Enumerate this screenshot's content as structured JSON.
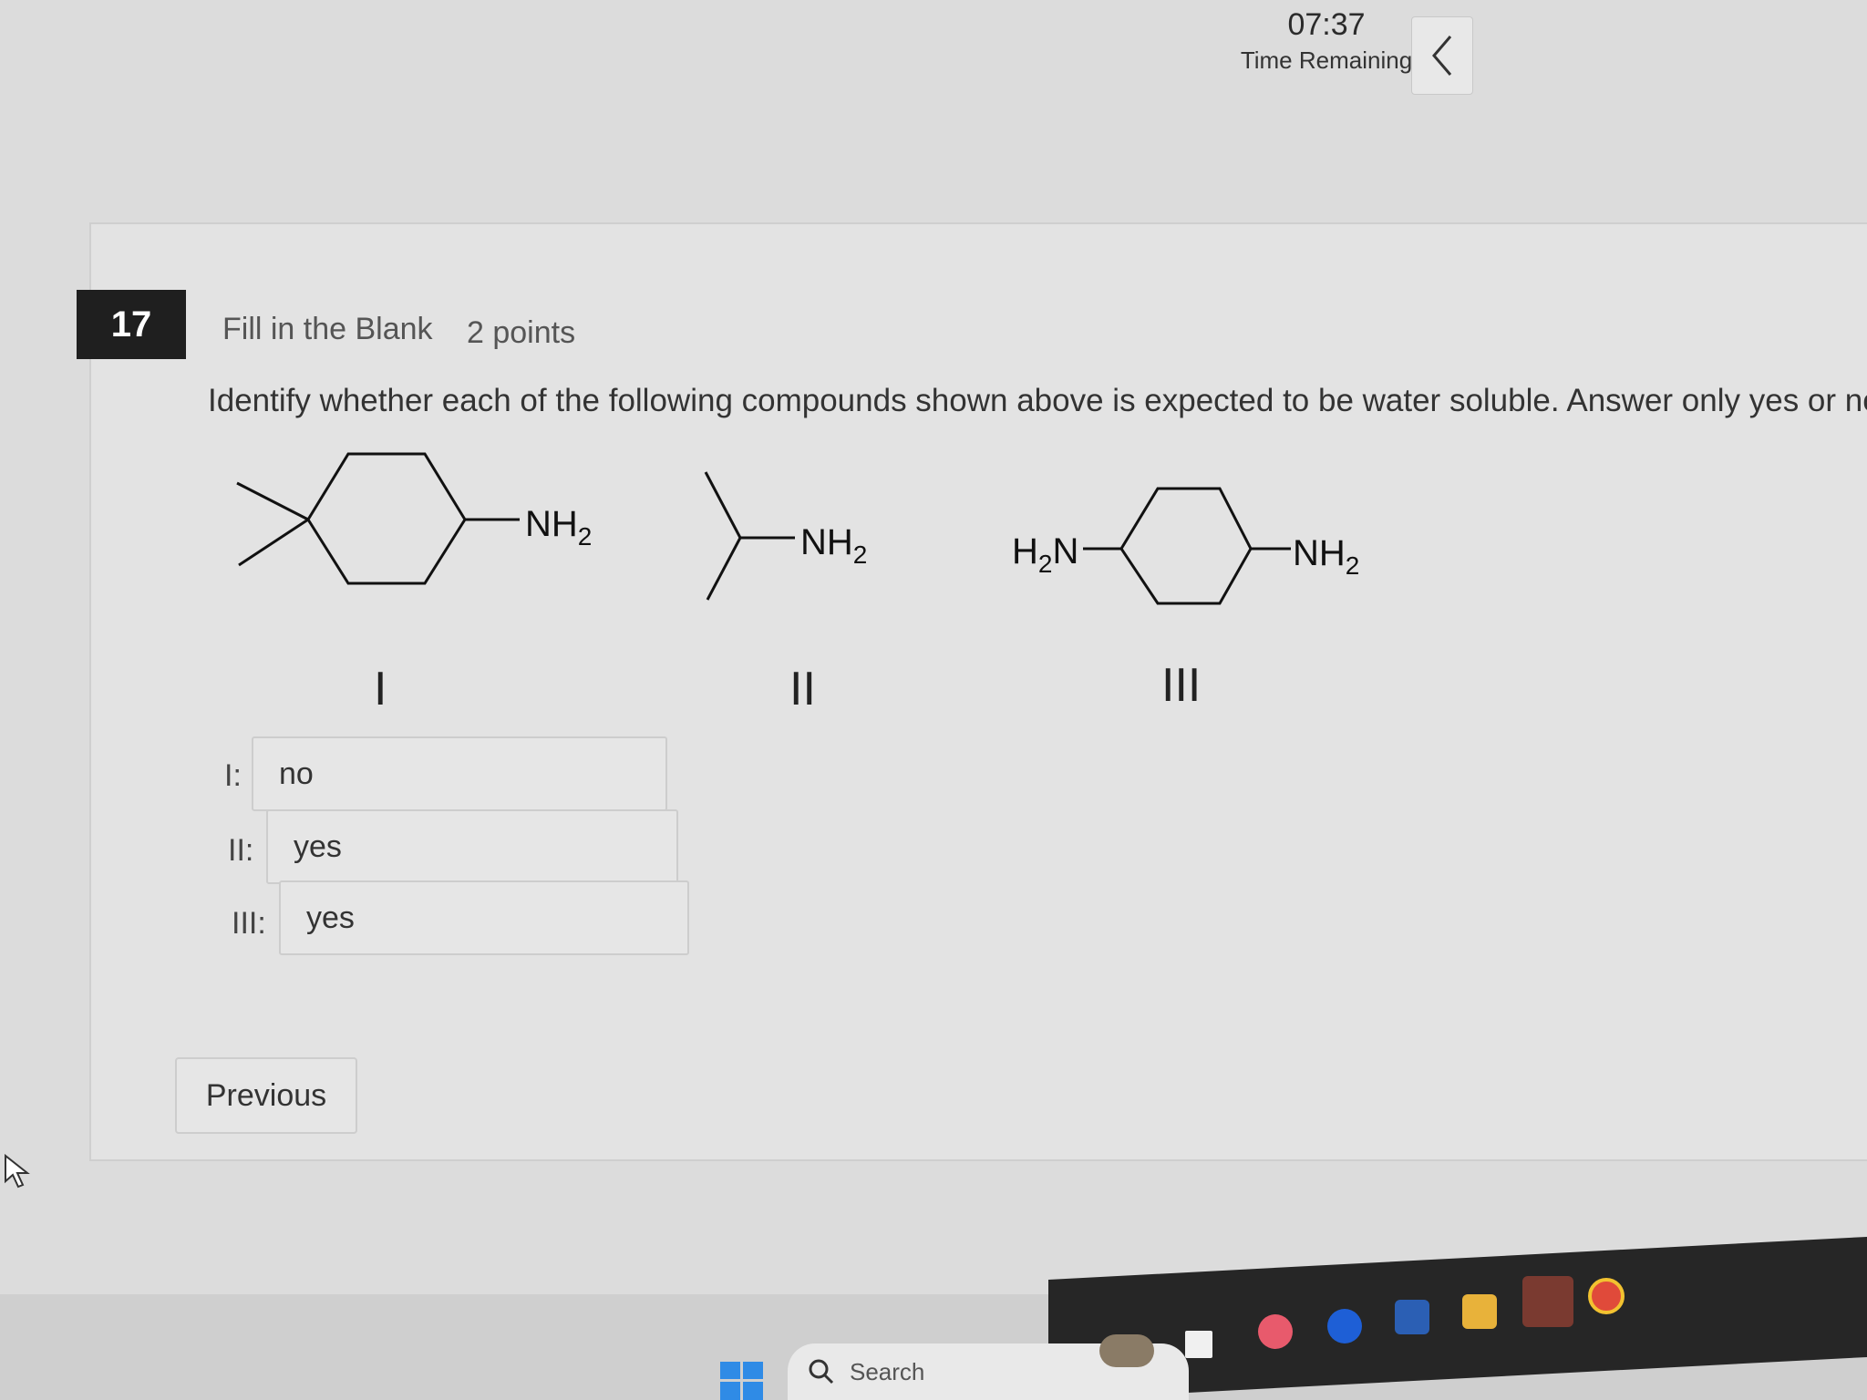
{
  "timer": {
    "time": "07:37",
    "label": "Time Remaining"
  },
  "question": {
    "number": "17",
    "type": "Fill in the Blank",
    "points": "2 points",
    "text": "Identify whether each of the following compounds shown above is expected to be water soluble. Answer only yes or no in the blank"
  },
  "structures": {
    "nh2_label": "NH",
    "nh2_sub": "2",
    "h2n_h": "H",
    "h2n_sub": "2",
    "h2n_n": "N"
  },
  "roman_labels": [
    "I",
    "II",
    "III"
  ],
  "answers": [
    {
      "label": "I:",
      "value": "no"
    },
    {
      "label": "II:",
      "value": "yes"
    },
    {
      "label": "III:",
      "value": "yes"
    }
  ],
  "buttons": {
    "previous": "Previous"
  },
  "taskbar": {
    "search_label": "Search"
  },
  "colors": {
    "accent": "#1f1f1f",
    "background": "#dcdcdc",
    "card": "#e3e3e3"
  }
}
